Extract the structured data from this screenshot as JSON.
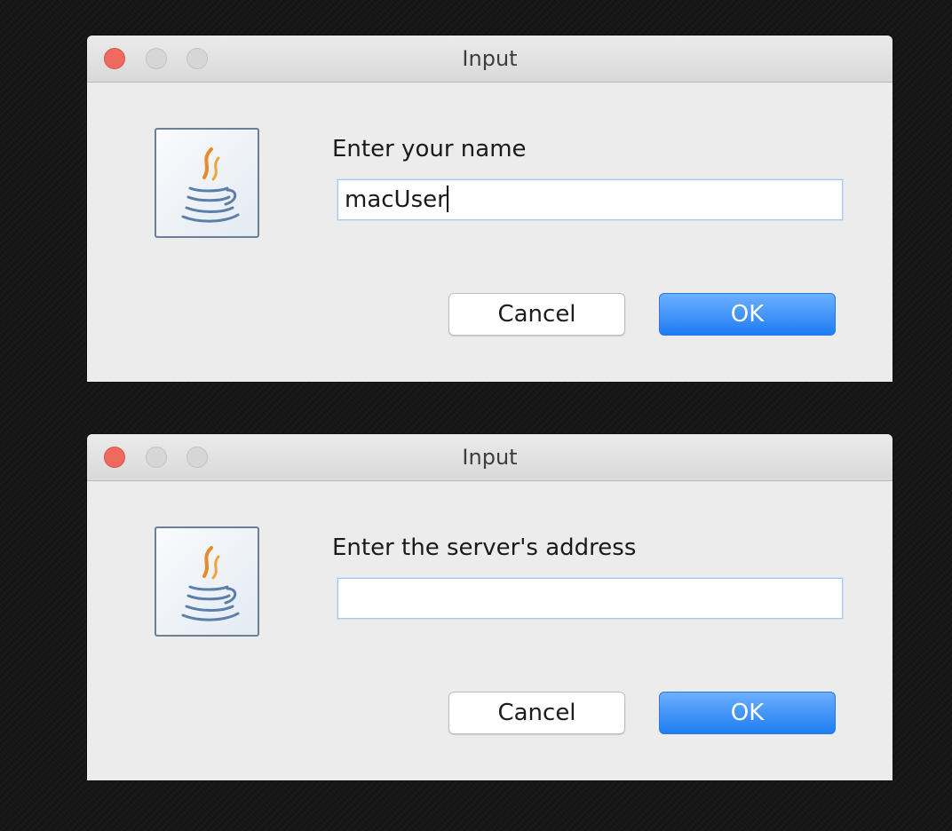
{
  "dialogs": [
    {
      "title": "Input",
      "prompt": "Enter your name",
      "input_value": "macUser",
      "input_placeholder": "",
      "cancel_label": "Cancel",
      "ok_label": "OK",
      "icon": "java-icon"
    },
    {
      "title": "Input",
      "prompt": "Enter the server's address",
      "input_value": "",
      "input_placeholder": "",
      "cancel_label": "Cancel",
      "ok_label": "OK",
      "icon": "java-icon"
    }
  ],
  "colors": {
    "close_button": "#ee6a5f",
    "ok_button": "#1e7cf3",
    "background": "#141414"
  }
}
